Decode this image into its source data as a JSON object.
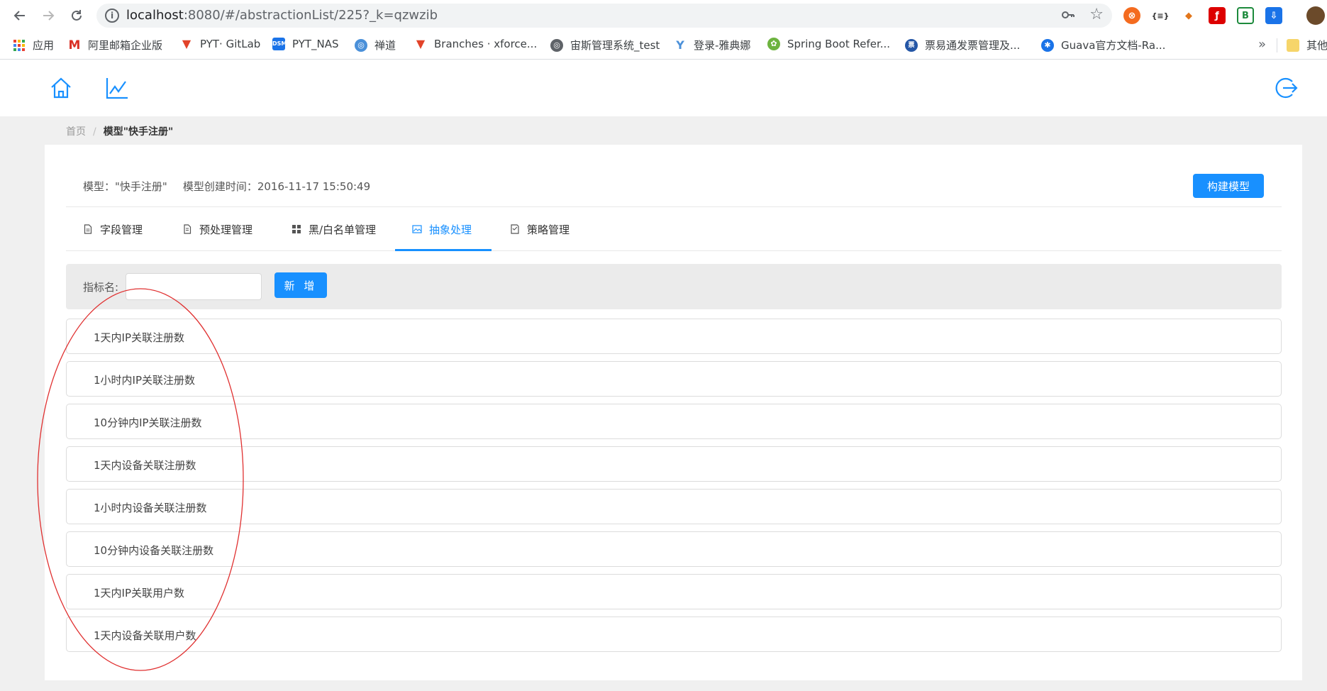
{
  "browser": {
    "url_host": "localhost",
    "url_rest": ":8080/#/abstractionList/225?_k=qzwzib",
    "bookmarks": [
      {
        "label": "应用",
        "icon": "apps-grid-icon",
        "color": "#ea4335"
      },
      {
        "label": "阿里邮箱企业版",
        "icon": "aliyun-mail-icon",
        "color": "#d93025"
      },
      {
        "label": "PYT· GitLab",
        "icon": "gitlab-icon",
        "color": "#e24329"
      },
      {
        "label": "PYT_NAS",
        "icon": "dsm-icon",
        "color": "#1a73e8"
      },
      {
        "label": "禅道",
        "icon": "globe-icon",
        "color": "#4a90d9"
      },
      {
        "label": "Branches · xforce...",
        "icon": "gitlab-icon",
        "color": "#e24329"
      },
      {
        "label": "宙斯管理系统_test",
        "icon": "globe-icon",
        "color": "#5f6368"
      },
      {
        "label": "登录-雅典娜",
        "icon": "athena-icon",
        "color": "#4a90d9"
      },
      {
        "label": "Spring Boot Refer...",
        "icon": "spring-icon",
        "color": "#6db33f"
      },
      {
        "label": "票易通发票管理及...",
        "icon": "invoice-icon",
        "color": "#2456a6"
      },
      {
        "label": "Guava官方文档-Ra...",
        "icon": "gear-globe-icon",
        "color": "#1a73e8"
      }
    ],
    "bookmarks_more": "»",
    "other_bookmarks": "其他"
  },
  "breadcrumb": {
    "home": "首页",
    "separator": "/",
    "current": "模型\"快手注册\""
  },
  "model": {
    "name_label": "模型：\"快手注册\"",
    "created_label": "模型创建时间：2016-11-17 15:50:49",
    "build_button": "构建模型"
  },
  "tabs": [
    {
      "label": "字段管理",
      "icon": "document-icon"
    },
    {
      "label": "预处理管理",
      "icon": "file-icon"
    },
    {
      "label": "黑/白名单管理",
      "icon": "grid-icon"
    },
    {
      "label": "抽象处理",
      "icon": "image-icon",
      "active": true
    },
    {
      "label": "策略管理",
      "icon": "strategy-icon"
    }
  ],
  "search": {
    "label": "指标名:",
    "value": "",
    "add_button": "新 增"
  },
  "metrics": [
    "1天内IP关联注册数",
    "1小时内IP关联注册数",
    "10分钟内IP关联注册数",
    "1天内设备关联注册数",
    "1小时内设备关联注册数",
    "10分钟内设备关联注册数",
    "1天内IP关联用户数",
    "1天内设备关联用户数"
  ],
  "colors": {
    "accent": "#1890ff",
    "annotation": "#e03030"
  }
}
